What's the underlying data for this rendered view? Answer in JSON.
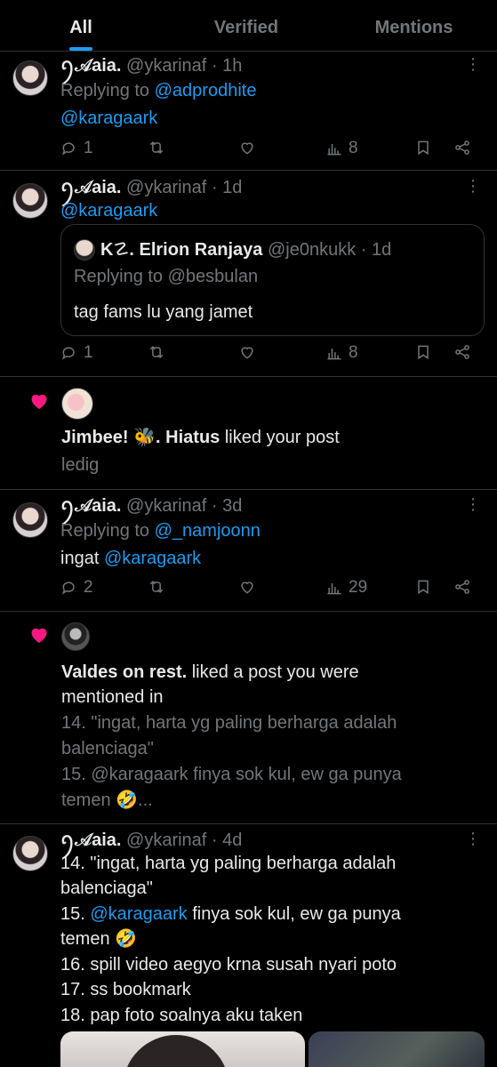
{
  "tabs": [
    {
      "label": "All",
      "active": true
    },
    {
      "label": "Verified",
      "active": false
    },
    {
      "label": "Mentions",
      "active": false
    }
  ],
  "posts": [
    {
      "name": "ꪆ𝒜aia.",
      "handle": "@ykarinaf",
      "time": "· 1h",
      "replying_prefix": "Replying to",
      "replying_to": "@adprodhite",
      "body_mention": "@karagaark",
      "replies": "1",
      "views": "8"
    },
    {
      "name": "ꪆ𝒜aia.",
      "handle": "@ykarinaf",
      "time": "· 1d",
      "body_mention": "@karagaark",
      "quote": {
        "name": "K☡. Elrion Ranjaya",
        "handle": "@je0nkukk",
        "time": "· 1d",
        "replying": "Replying to @besbulan",
        "text": "tag fams lu yang jamet"
      },
      "replies": "1",
      "views": "8"
    },
    {
      "name": "ꪆ𝒜aia.",
      "handle": "@ykarinaf",
      "time": "· 3d",
      "replying_prefix": "Replying to",
      "replying_to": "@_namjoonn",
      "body_prefix": "ingat",
      "body_mention": "@karagaark",
      "replies": "2",
      "views": "29"
    },
    {
      "name": "ꪆ𝒜aia.",
      "handle": "@ykarinaf",
      "time": "· 4d",
      "lines": [
        "14. \"ingat, harta yg paling berharga adalah",
        "balenciaga\""
      ],
      "line15_prefix": "15.",
      "line15_mention": "@karagaark",
      "line15_rest": "finya sok kul, ew ga punya",
      "line15b": "temen 🤣",
      "lines_after": [
        "16. spill video aegyo krna susah nyari poto",
        "17. ss bookmark",
        "18. pap foto soalnya aku taken"
      ]
    }
  ],
  "likes": [
    {
      "actor": "Jimbee! 🐝. Hiatus",
      "action": "liked your post",
      "snippet": "ledig"
    },
    {
      "actor": "Valdes on rest.",
      "action": "liked a post you were",
      "action2": "mentioned in",
      "snippet_lines": [
        "14. \"ingat, harta yg paling berharga adalah",
        "balenciaga\"",
        "15. @karagaark finya sok kul, ew ga punya",
        "temen 🤣..."
      ]
    }
  ],
  "icons": {
    "reply": "reply-icon",
    "repost": "repost-icon",
    "like": "like-icon",
    "views": "views-icon",
    "bookmark": "bookmark-icon",
    "share": "share-icon",
    "more": "more-icon",
    "heart": "heart-icon"
  },
  "colors": {
    "accent": "#1d9bf0",
    "heart": "#f91880",
    "muted": "#71767b",
    "background": "#000000"
  }
}
